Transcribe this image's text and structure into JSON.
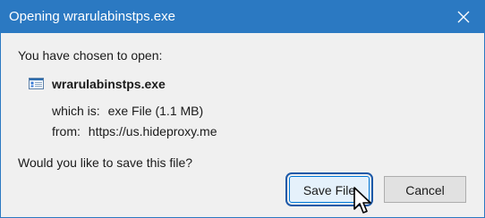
{
  "window": {
    "title": "Opening wrarulabinstps.exe"
  },
  "dialog": {
    "prompt": "You have chosen to open:",
    "file_name": "wrarulabinstps.exe",
    "which_is_label": "which is:",
    "which_is_value": "exe File (1.1 MB)",
    "from_label": "from:",
    "from_value": "https://us.hideproxy.me",
    "question": "Would you like to save this file?"
  },
  "buttons": {
    "save_label": "Save File",
    "cancel_label": "Cancel"
  },
  "icons": {
    "close": "close-icon",
    "file": "file-icon",
    "cursor": "mouse-cursor-icon"
  },
  "colors": {
    "titlebar": "#2b79c2",
    "background": "#f0f0f0",
    "focus_button_border": "#0078d7"
  }
}
